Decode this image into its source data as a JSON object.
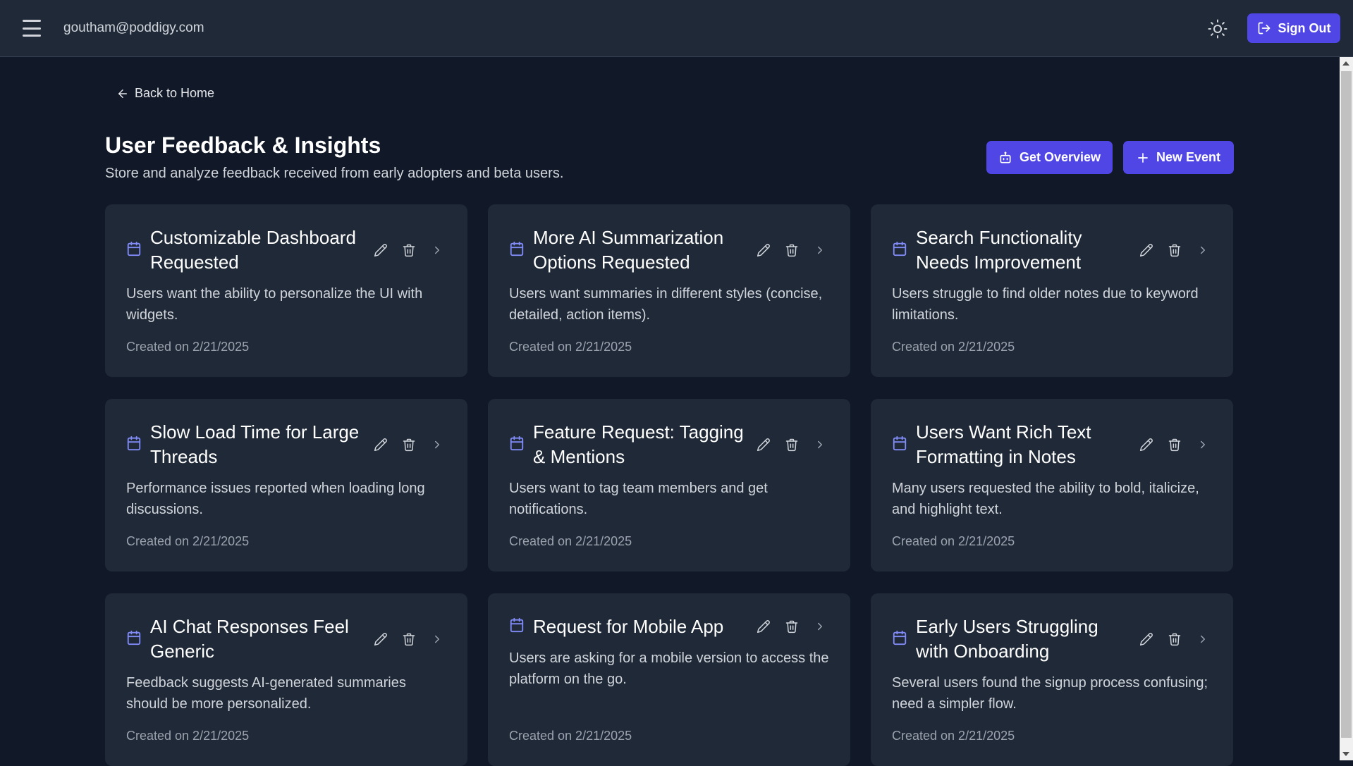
{
  "header": {
    "user_email": "goutham@poddigy.com",
    "sign_out_label": "Sign Out"
  },
  "nav": {
    "back_label": "Back to Home"
  },
  "page": {
    "title": "User Feedback & Insights",
    "subtitle": "Store and analyze feedback received from early adopters and beta users.",
    "overview_label": "Get Overview",
    "new_event_label": "New Event"
  },
  "colors": {
    "background": "#111827",
    "surface": "#1f2937",
    "accent": "#4f46e5",
    "calendar_icon": "#818cf8"
  },
  "cards": [
    {
      "title": "Customizable Dashboard Requested",
      "description": "Users want the ability to personalize the UI with widgets.",
      "date": "Created on 2/21/2025"
    },
    {
      "title": "More AI Summarization Options Requested",
      "description": "Users want summaries in different styles (concise, detailed, action items).",
      "date": "Created on 2/21/2025"
    },
    {
      "title": "Search Functionality Needs Improvement",
      "description": "Users struggle to find older notes due to keyword limitations.",
      "date": "Created on 2/21/2025"
    },
    {
      "title": "Slow Load Time for Large Threads",
      "description": "Performance issues reported when loading long discussions.",
      "date": "Created on 2/21/2025"
    },
    {
      "title": "Feature Request: Tagging & Mentions",
      "description": "Users want to tag team members and get notifications.",
      "date": "Created on 2/21/2025"
    },
    {
      "title": "Users Want Rich Text Formatting in Notes",
      "description": "Many users requested the ability to bold, italicize, and highlight text.",
      "date": "Created on 2/21/2025"
    },
    {
      "title": "AI Chat Responses Feel Generic",
      "description": "Feedback suggests AI-generated summaries should be more personalized.",
      "date": "Created on 2/21/2025"
    },
    {
      "title": "Request for Mobile App",
      "description": "Users are asking for a mobile version to access the platform on the go.",
      "date": "Created on 2/21/2025"
    },
    {
      "title": "Early Users Struggling with Onboarding",
      "description": "Several users found the signup process confusing; need a simpler flow.",
      "date": "Created on 2/21/2025"
    }
  ]
}
